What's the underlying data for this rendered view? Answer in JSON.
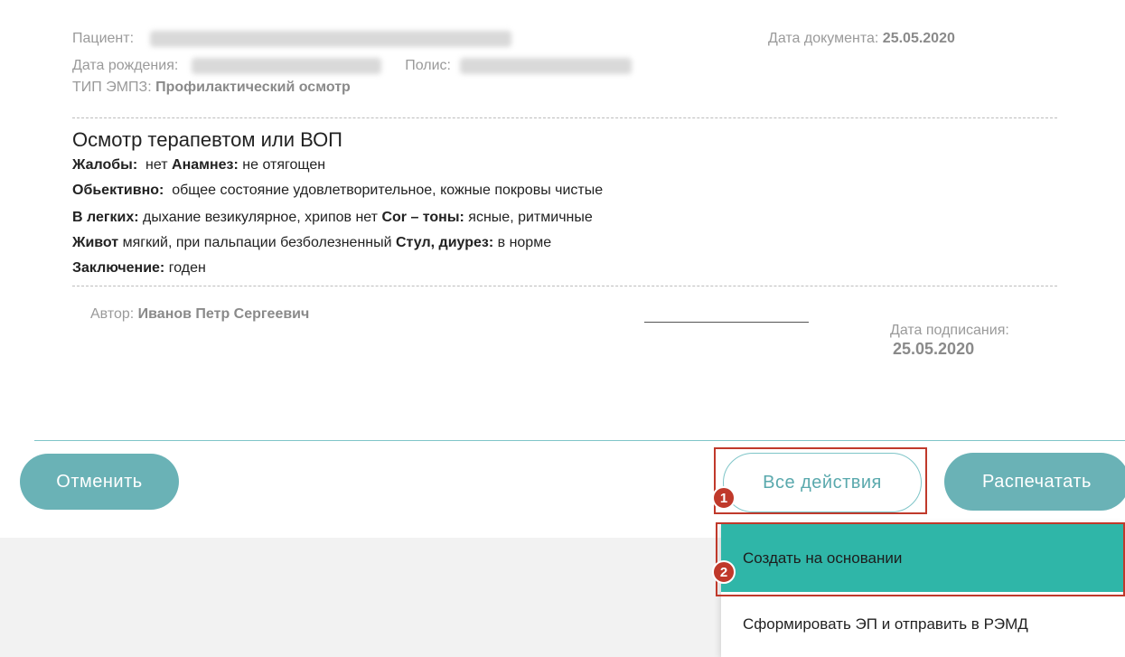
{
  "header": {
    "patient_label": "Пациент:",
    "birth_label": "Дата рождения:",
    "policy_label": "Полис:",
    "emz_type_label": "ТИП ЭМПЗ:",
    "emz_type_value": "Профилактический осмотр",
    "doc_date_label": "Дата документа:",
    "doc_date_value": "25.05.2020"
  },
  "exam": {
    "title": "Осмотр терапевтом или ВОП",
    "complaints_label": "Жалобы:",
    "complaints_value": "нет",
    "anamnesis_label": "Анамнез:",
    "anamnesis_value": "не отягощен",
    "objective_label": "Обьективно:",
    "objective_value": "общее состояние удовлетворительное, кожные покровы чистые",
    "lungs_label": "В легких:",
    "lungs_value": "дыхание везикулярное, хрипов нет",
    "heart_label": "Cor – тоны:",
    "heart_value": "ясные, ритмичные",
    "abdomen_label": "Живот",
    "abdomen_value": "мягкий, при пальпации безболезненный",
    "stool_label": "Стул, диурез:",
    "stool_value": "в норме",
    "conclusion_label": "Заключение:",
    "conclusion_value": "годен"
  },
  "footer": {
    "author_label": "Автор:",
    "author_value": "Иванов Петр Сергеевич",
    "sign_date_label": "Дата подписания:",
    "sign_date_value": "25.05.2020"
  },
  "buttons": {
    "cancel": "Отменить",
    "all_actions": "Все действия",
    "print": "Распечатать"
  },
  "menu": {
    "items": [
      {
        "label": "Создать на основании"
      },
      {
        "label": "Сформировать ЭП и отправить в РЭМД"
      }
    ]
  },
  "badges": [
    "1",
    "2"
  ],
  "colors": {
    "accent": "#6ab2b6",
    "menu_active": "#2fb6a8",
    "highlight": "#c0392b"
  }
}
